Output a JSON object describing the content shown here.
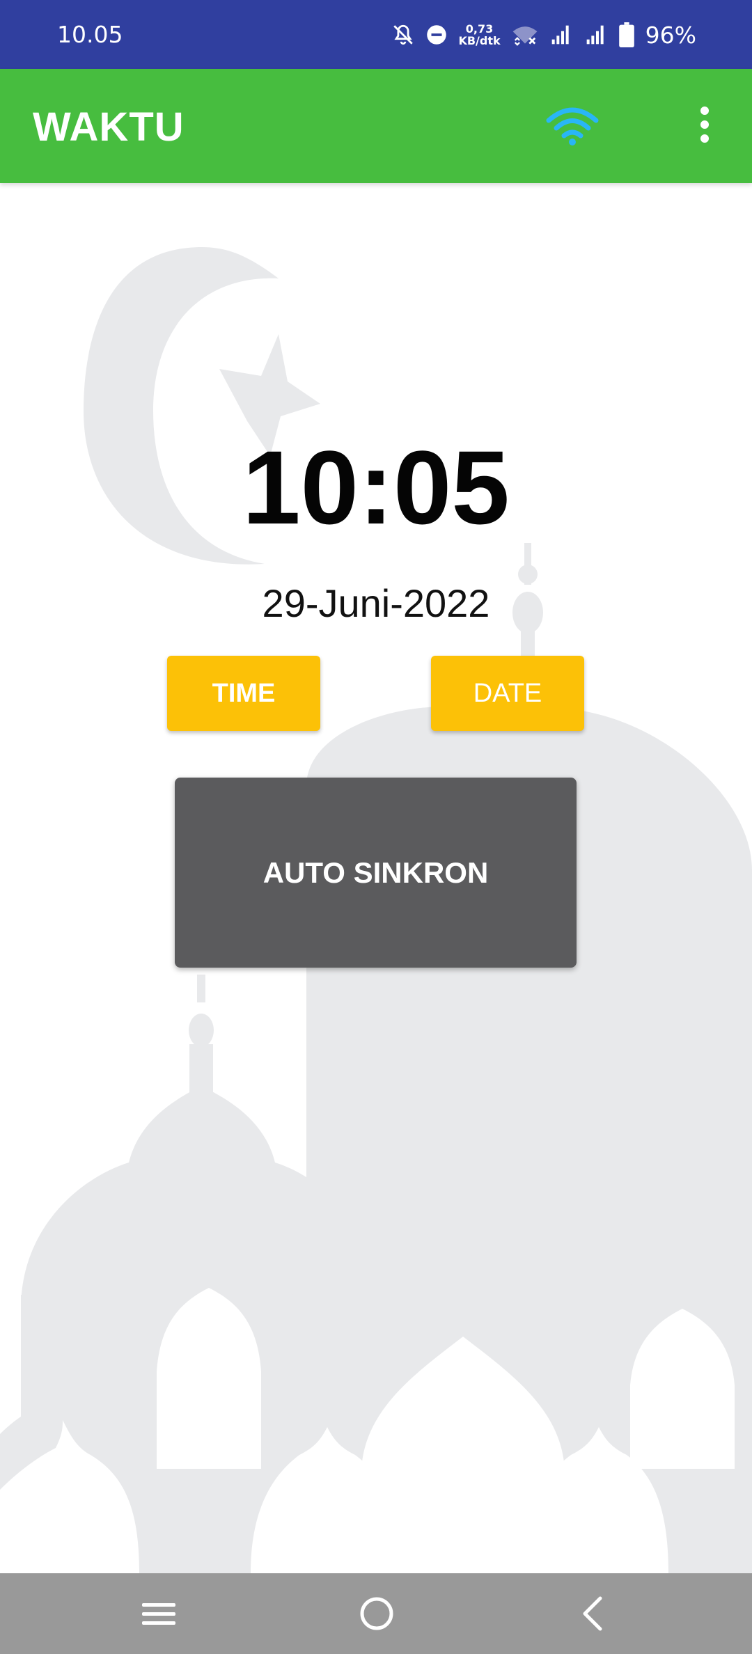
{
  "status_bar": {
    "time": "10.05",
    "net_speed_value": "0,73",
    "net_speed_unit": "KB/dtk",
    "battery_percent": "96%",
    "icons": [
      "mute-notifications-icon",
      "do-not-disturb-icon",
      "wifi-off-icon",
      "signal-icon",
      "signal-icon",
      "battery-icon"
    ]
  },
  "app_bar": {
    "title": "WAKTU",
    "wifi_icon_color": "#29b6f6",
    "icons": [
      "wifi-icon",
      "overflow-menu-icon"
    ]
  },
  "main": {
    "clock": "10:05",
    "date": "29-Juni-2022",
    "time_button": "TIME",
    "date_button": "DATE",
    "sync_button": "AUTO SINKRON"
  },
  "nav_bar": {
    "icons": [
      "recents-icon",
      "home-icon",
      "back-icon"
    ]
  },
  "colors": {
    "status_bar": "#303f9f",
    "app_bar": "#47bd3f",
    "accent_button": "#fcc107",
    "sync_button": "#5b5b5d",
    "nav_bar": "#999999",
    "background_art": "#e8e9eb"
  }
}
